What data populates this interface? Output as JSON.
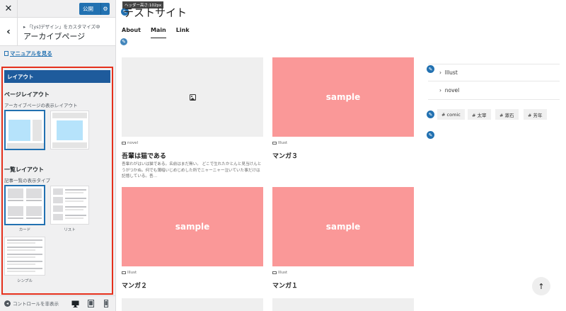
{
  "customizer": {
    "close_icon": "close-icon",
    "publish_label": "公開",
    "breadcrumb": "「[ys]デザイン」をカスタマイズ中",
    "panel_title": "アーカイブページ",
    "manual_link": "マニュアルを見る",
    "section_title": "レイアウト",
    "page_layout": {
      "label": "ページレイアウト",
      "description": "アーカイブページの表示レイアウト"
    },
    "list_layout": {
      "label": "一覧レイアウト",
      "description": "記事一覧の表示タイプ",
      "options": [
        "カード",
        "リスト",
        "シンプル"
      ]
    },
    "footer": {
      "hide_controls": "コントロールを非表示"
    }
  },
  "preview": {
    "header_height_tip": "ヘッダー高さ:102px",
    "site_title": "テストサイト",
    "nav": [
      "About",
      "Main",
      "Link"
    ],
    "posts": [
      {
        "category": "novel",
        "title": "吾輩は猫である",
        "excerpt": "吾輩わがはいは猫である。名前はまだ無い。 どこで生れたかとんと見当けんとうがつかぬ。何でも薄暗いじめじめした所でニャーニャー泣いていた事だけは記憶している。吾…",
        "thumb": ""
      },
      {
        "category": "Illust",
        "title": "マンガ３",
        "excerpt": "",
        "thumb": "sample"
      },
      {
        "category": "Illust",
        "title": "マンガ２",
        "excerpt": "",
        "thumb": "sample"
      },
      {
        "category": "Illust",
        "title": "マンガ１",
        "excerpt": "",
        "thumb": "sample"
      }
    ],
    "sidebar_categories": [
      "Illust",
      "novel"
    ],
    "tags": [
      "# comic",
      "# 太宰",
      "# 漱石",
      "# 芳年"
    ]
  },
  "colors": {
    "accent": "#2271b1",
    "section_header": "#1e5b9c",
    "highlight_frame": "#e5301c",
    "sample_thumb": "#fa9898"
  }
}
